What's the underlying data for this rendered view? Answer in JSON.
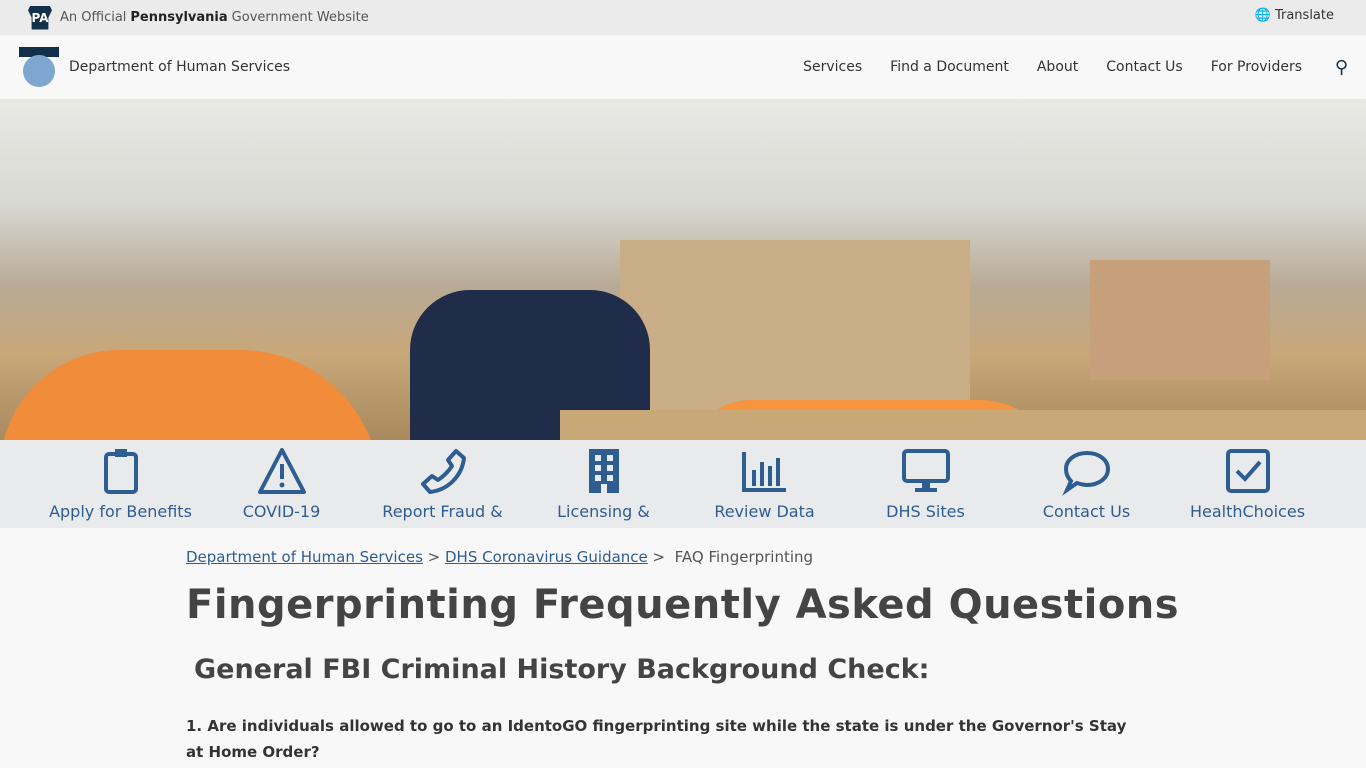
{
  "topbar": {
    "badge": "PA",
    "prefix": "An Official",
    "state": "Pennsylvania",
    "suffix": "Government Website",
    "translate": "Translate"
  },
  "header": {
    "title": "Department of Human Services",
    "nav": [
      "Services",
      "Find a Document",
      "About",
      "Contact Us",
      "For Providers"
    ]
  },
  "quick_links": [
    {
      "label": "Apply for Benefits",
      "icon": "clipboard-icon"
    },
    {
      "label": "COVID-19",
      "icon": "warning-icon"
    },
    {
      "label": "Report Fraud &",
      "icon": "phone-icon"
    },
    {
      "label": "Licensing &",
      "icon": "building-icon"
    },
    {
      "label": "Review Data",
      "icon": "bar-chart-icon"
    },
    {
      "label": "DHS Sites",
      "icon": "monitor-icon"
    },
    {
      "label": "Contact Us",
      "icon": "chat-icon"
    },
    {
      "label": "HealthChoices",
      "icon": "checkbox-icon"
    }
  ],
  "accent": "#2e5d92",
  "breadcrumb": {
    "items": [
      "Department of Human Services",
      "DHS Coronavirus Guidance"
    ],
    "current": "FAQ Fingerprinting"
  },
  "main": {
    "title": "Fingerprinting Frequently Asked Questions",
    "subtitle": "General FBI Criminal History Background Check:",
    "question1": "1. Are individuals allowed to go to an IdentoGO fingerprinting site while the state is under the Governor's Stay at Home Order?"
  }
}
